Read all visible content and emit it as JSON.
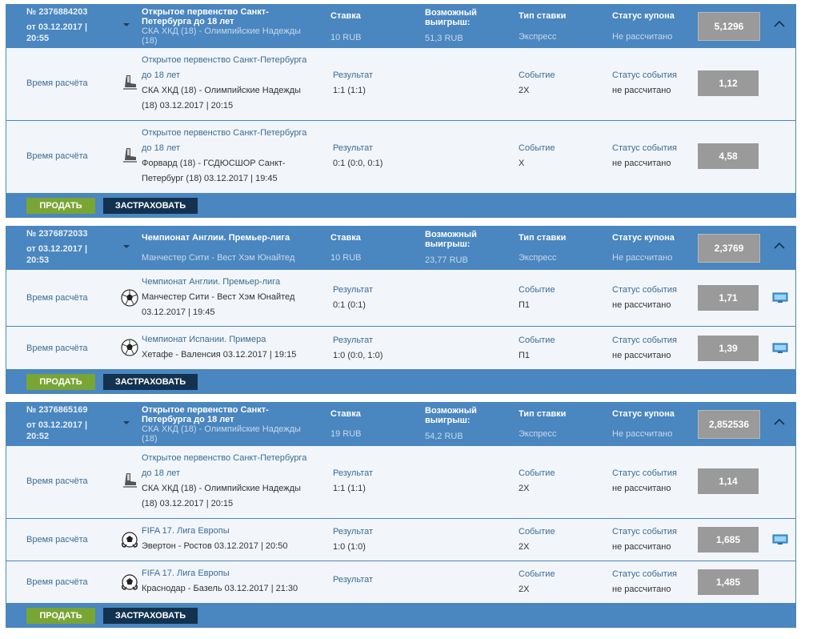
{
  "labels": {
    "stake": "Ставка",
    "possible_win": "Возможный выигрыш:",
    "bet_type": "Тип ставки",
    "coupon_status": "Статус купона",
    "calc_time": "Время расчёта",
    "result": "Результат",
    "event": "Событие",
    "event_status": "Статус события",
    "sell": "ПРОДАТЬ",
    "insure": "ЗАСТРАХОВАТЬ"
  },
  "icons": {
    "caret": "caret-down-icon",
    "collapse": "chevron-up-icon",
    "tv": "tv-broadcast-icon",
    "hockey": "hockey-skate-icon",
    "football": "soccer-ball-icon",
    "esports": "esports-icon"
  },
  "colors": {
    "header_bg": "#4a86bf",
    "sell_btn": "#79a534",
    "insure_btn": "#12324f",
    "coef_bg": "#9a9a9a"
  },
  "coupons": [
    {
      "number": "№ 2376884203",
      "date": "от 03.12.2017 | 20:55",
      "tournament": "Открытое первенство Санкт-Петербурга до 18 лет",
      "teams": "СКА ХКД (18) - Олимпийские Надежды (18)",
      "stake": "10 RUB",
      "win": "51,3 RUB",
      "type": "Экспресс",
      "status": "Не рассчитано",
      "coef": "5,1296",
      "events": [
        {
          "tournament": "Открытое первенство Санкт-Петербурга до 18 лет",
          "match": "СКА ХКД (18) - Олимпийские Надежды (18) 03.12.2017 | 20:15",
          "result": "1:1 (1:1)",
          "event": "2Х",
          "status": "не рассчитано",
          "coef": "1,12"
        },
        {
          "tournament": "Открытое первенство Санкт-Петербурга до 18 лет",
          "match": "Форвард (18) - ГСДЮСШОР Санкт-Петербург (18) 03.12.2017 | 19:45",
          "result": "0:1 (0:0, 0:1)",
          "event": "Х",
          "status": "не рассчитано",
          "coef": "4,58"
        }
      ]
    },
    {
      "number": "№ 2376872033",
      "date": "от 03.12.2017 | 20:53",
      "tournament": "Чемпионат Англии. Премьер-лига",
      "teams": "Манчестер Сити - Вест Хэм Юнайтед",
      "stake": "10 RUB",
      "win": "23,77 RUB",
      "type": "Экспресс",
      "status": "Не рассчитано",
      "coef": "2,3769",
      "events": [
        {
          "tournament": "Чемпионат Англии. Премьер-лига",
          "match": "Манчестер Сити - Вест Хэм Юнайтед 03.12.2017 | 19:45",
          "result": "0:1 (0:1)",
          "event": "П1",
          "status": "не рассчитано",
          "coef": "1,71"
        },
        {
          "tournament": "Чемпионат Испании. Примера",
          "match": "Хетафе - Валенсия 03.12.2017 | 19:15",
          "result": "1:0 (0:0, 1:0)",
          "event": "П1",
          "status": "не рассчитано",
          "coef": "1,39"
        }
      ]
    },
    {
      "number": "№ 2376865169",
      "date": "от 03.12.2017 | 20:52",
      "tournament": "Открытое первенство Санкт-Петербурга до 18 лет",
      "teams": "СКА ХКД (18) - Олимпийские Надежды (18)",
      "stake": "19 RUB",
      "win": "54,2 RUB",
      "type": "Экспресс",
      "status": "Не рассчитано",
      "coef": "2,852536",
      "events": [
        {
          "tournament": "Открытое первенство Санкт-Петербурга до 18 лет",
          "match": "СКА ХКД (18) - Олимпийские Надежды (18) 03.12.2017 | 20:15",
          "result": "1:1 (1:1)",
          "event": "2Х",
          "status": "не рассчитано",
          "coef": "1,14"
        },
        {
          "tournament": "FIFA 17. Лига Европы",
          "match": "Эвертон - Ростов 03.12.2017 | 20:50",
          "result": "1:0 (1:0)",
          "event": "2Х",
          "status": "не рассчитано",
          "coef": "1,685"
        },
        {
          "tournament": "FIFA 17. Лига Европы",
          "match": "Краснодар - Базель 03.12.2017 | 21:30",
          "result": "",
          "event": "2Х",
          "status": "не рассчитано",
          "coef": "1,485"
        }
      ]
    }
  ]
}
